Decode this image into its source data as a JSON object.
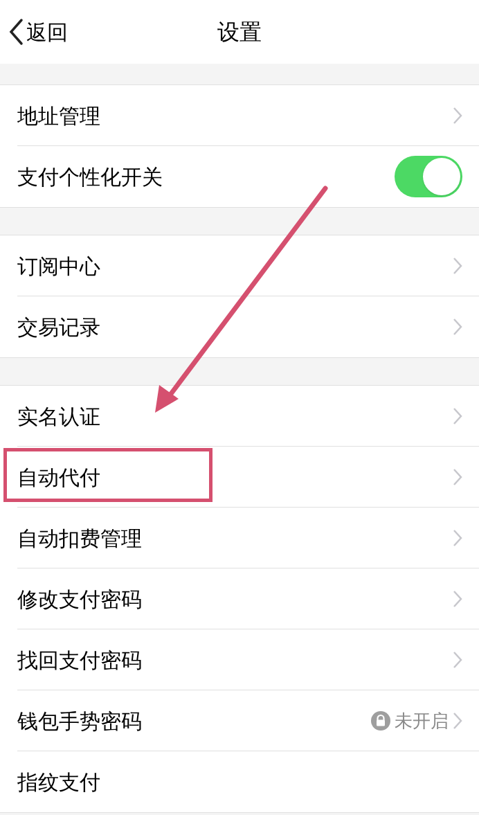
{
  "nav": {
    "back": "返回",
    "title": "设置"
  },
  "groups": [
    {
      "rows": [
        {
          "kind": "link",
          "label": "地址管理",
          "highlighted": false
        },
        {
          "kind": "toggle",
          "label": "支付个性化开关",
          "on": true,
          "highlighted": false
        }
      ]
    },
    {
      "rows": [
        {
          "kind": "link",
          "label": "订阅中心",
          "highlighted": false
        },
        {
          "kind": "link",
          "label": "交易记录",
          "highlighted": false
        }
      ]
    },
    {
      "rows": [
        {
          "kind": "link",
          "label": "实名认证",
          "highlighted": false
        },
        {
          "kind": "link",
          "label": "自动代付",
          "highlighted": true
        },
        {
          "kind": "link",
          "label": "自动扣费管理",
          "highlighted": false
        },
        {
          "kind": "link",
          "label": "修改支付密码",
          "highlighted": false
        },
        {
          "kind": "link",
          "label": "找回支付密码",
          "highlighted": false
        },
        {
          "kind": "status",
          "label": "钱包手势密码",
          "value": "未开启",
          "highlighted": false
        },
        {
          "kind": "plain",
          "label": "指纹支付",
          "highlighted": false
        }
      ]
    }
  ],
  "annotations": [
    {
      "kind": "arrow"
    }
  ]
}
